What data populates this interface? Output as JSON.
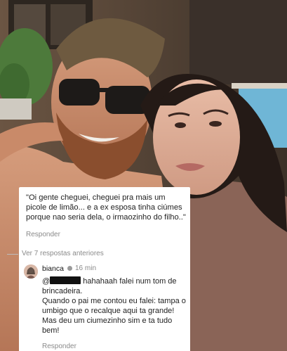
{
  "quote": {
    "text": "\"Oi gente cheguei, cheguei pra mais um picole de limão... e a ex esposa tinha ciúmes porque nao seria dela, o irmaozinho do filho..\"",
    "reply_label": "Responder"
  },
  "thread": {
    "view_replies_label": "Ver 7 respostas anteriores"
  },
  "comment": {
    "username": "bianca",
    "time": "16 min",
    "mention_prefix": "@",
    "text_after_mention": " hahahaah falei num tom de brincadeira.",
    "line2": "Quando o pai me contou eu falei: tampa o umbigo que o recalque aqui ta grande!",
    "line3": "Mas deu um ciumezinho sim e ta tudo bem!",
    "reply_label": "Responder"
  },
  "colors": {
    "card_bg": "#ffffff",
    "meta_text": "#8a8a8a",
    "body_text": "#222222"
  }
}
